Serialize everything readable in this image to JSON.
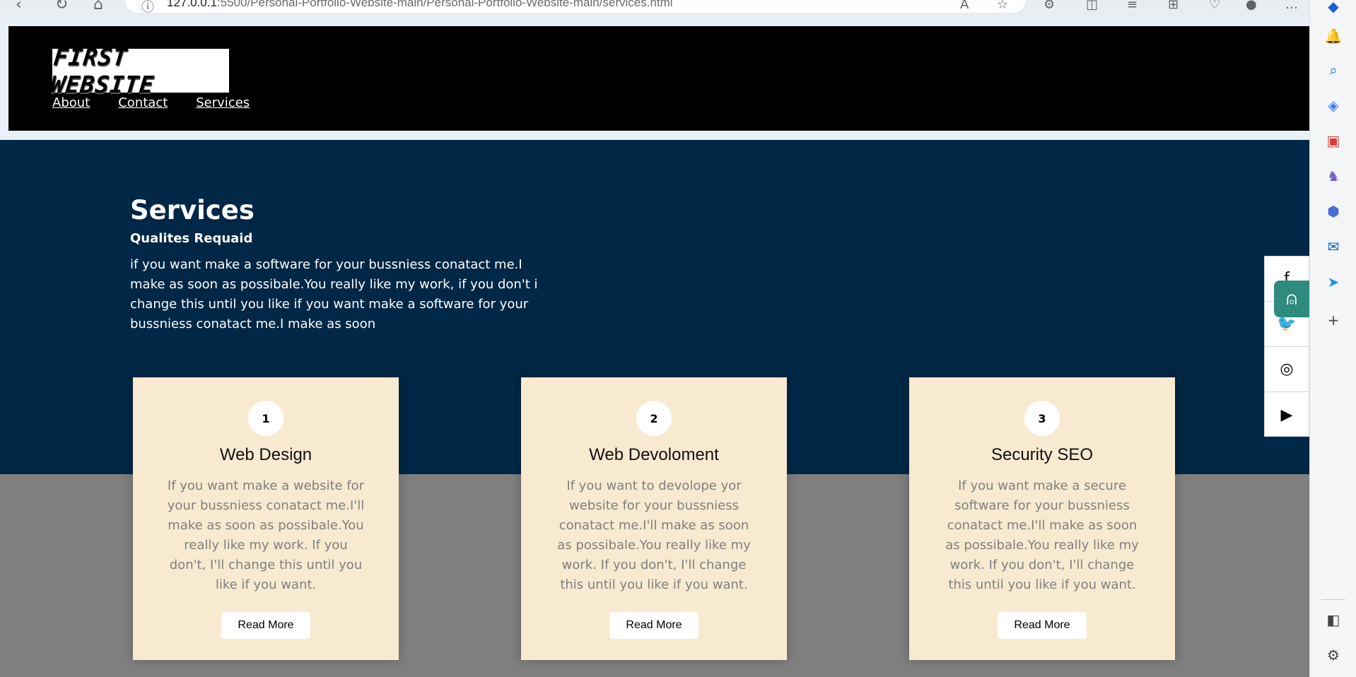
{
  "browser": {
    "url_host": "127.0.0.1",
    "url_path": ":5500/Personal-Portfolio-Website-main/Personal-Portfolio-Website-main/services.html"
  },
  "site": {
    "logo_text": "FIRST WEBSITE",
    "nav": [
      {
        "label": "About"
      },
      {
        "label": "Contact"
      },
      {
        "label": "Services"
      }
    ]
  },
  "services": {
    "title": "Services",
    "subtitle": "Qualites Requaid",
    "description": "if you want make a software for your bussniess conatact me.I\nmake as soon as possibale.You really like my work, if you don't i\nchange this until you like if you want make a software for your\nbussniess conatact me.I make as soon"
  },
  "cards": [
    {
      "number": "1",
      "title": "Web Design",
      "text": "If you want make a website for your bussniess conatact me.I'll make as soon as possibale.You really like my work. If you don't, I'll change this until you like if you want.",
      "button": "Read More"
    },
    {
      "number": "2",
      "title": "Web Devoloment",
      "text": "If you want to devolope yor website for your bussniess conatact me.I'll make as soon as possibale.You really like my work. If you don't, I'll change this until you like if you want.",
      "button": "Read More"
    },
    {
      "number": "3",
      "title": "Security SEO",
      "text": "If you want make a secure software for your bussniess conatact me.I'll make as soon as possibale.You really like my work. If you don't, I'll change this until you like if you want.",
      "button": "Read More"
    }
  ],
  "social": [
    "facebook-icon",
    "twitter-icon",
    "instagram-icon",
    "youtube-icon"
  ],
  "colors": {
    "header_bg": "#000000",
    "hero_bg": "#002745",
    "card_bg": "#f8ead0",
    "band_bg": "#7f7f7f"
  }
}
